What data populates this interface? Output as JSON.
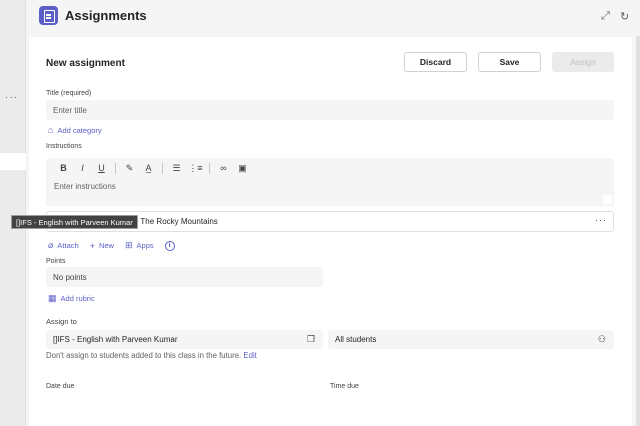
{
  "left_rail": {
    "dots": "···"
  },
  "header": {
    "title": "Assignments",
    "expand_icon": "expand-icon",
    "refresh_icon": "refresh-icon"
  },
  "form": {
    "heading": "New assignment",
    "buttons": {
      "discard": "Discard",
      "save": "Save",
      "assign": "Assign"
    },
    "title": {
      "label": "Title (required)",
      "placeholder": "Enter title"
    },
    "add_category": "Add category",
    "instructions": {
      "label": "Instructions",
      "placeholder": "Enter instructions"
    },
    "toolbar_icons": [
      "B",
      "I",
      "U",
      "highlight-icon",
      "font-color-icon",
      "bullet-list-icon",
      "numbered-list-icon",
      "link-icon",
      "image-icon"
    ],
    "resource": {
      "name": "ns - The Rocky Mountains",
      "menu": "···"
    },
    "tooltip": "[]IFS - English with Parveen Kumar",
    "attach": {
      "attach": "Attach",
      "new": "New",
      "apps": "Apps"
    },
    "points": {
      "label": "Points",
      "value": "No points"
    },
    "add_rubric": "Add rubric",
    "assign_to": {
      "label": "Assign to",
      "class": "[]IFS - English with Parveen Kumar",
      "students": "All students",
      "hint": "Don't assign to students added to this class in the future.",
      "edit": "Edit"
    },
    "date_due": "Date due",
    "time_due": "Time due"
  }
}
